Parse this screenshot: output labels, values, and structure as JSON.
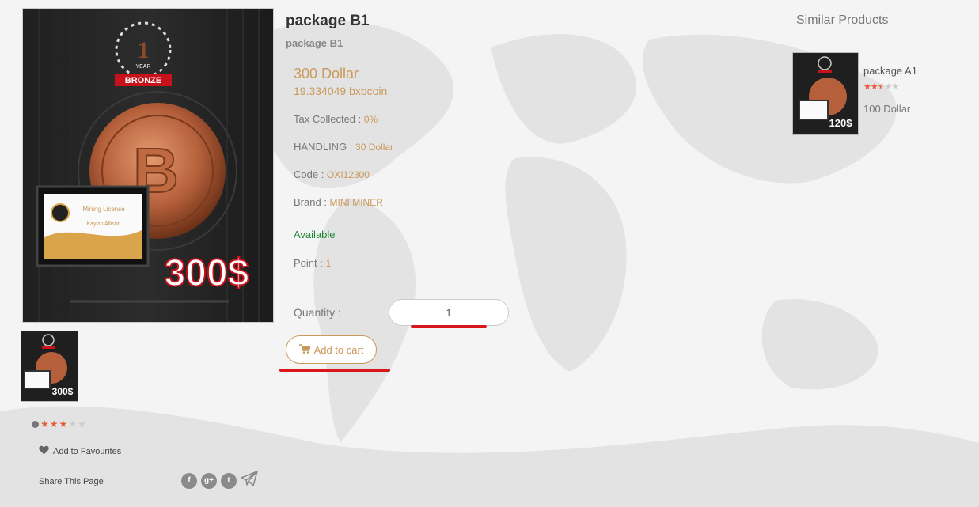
{
  "product": {
    "title": "package B1",
    "subtitle": "package B1",
    "price": "300 Dollar",
    "price_coin": "19.334049 bxbcoin",
    "tax_label": "Tax Collected : ",
    "tax_value": "0%",
    "handling_label": "HANDLING : ",
    "handling_value": "30 Dollar",
    "code_label": "Code : ",
    "code_value": "OXI12300",
    "brand_label": "Brand : ",
    "brand_value": "MINI MINER",
    "availability": "Available",
    "point_label": "Point : ",
    "point_value": "1",
    "quantity_label": "Quantity :",
    "quantity_value": "1",
    "add_to_cart_label": "Add to cart",
    "rating": 3,
    "rating_max": 5
  },
  "product_image": {
    "badge_number": "1",
    "badge_year": "YEAR",
    "badge_tier": "BRONZE",
    "price_text": "300$",
    "certificate_title": "Mining License",
    "certificate_name": "Kayvin Allison"
  },
  "actions": {
    "favourites_label": "Add to Favourites",
    "share_label": "Share This Page",
    "social_icons": [
      "facebook-icon",
      "google-plus-icon",
      "twitter-icon",
      "telegram-icon"
    ],
    "social_glyphs": {
      "facebook": "f",
      "google": "g+",
      "twitter": "t"
    }
  },
  "similar": {
    "heading": "Similar Products",
    "items": [
      {
        "name": "package A1",
        "price": "100 Dollar",
        "rating": 2.5,
        "rating_max": 5,
        "image_price_text": "120$"
      }
    ]
  },
  "colors": {
    "accent": "#c9995a",
    "available": "#1f8a3a",
    "star": "#e65c39",
    "highlight_underline": "#d9161c"
  }
}
